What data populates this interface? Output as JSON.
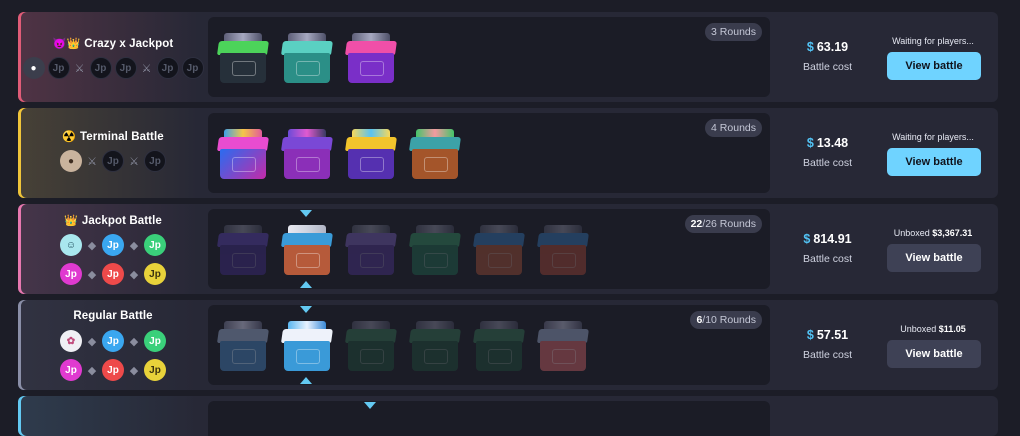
{
  "battles": [
    {
      "mode_icon": "😈👑",
      "title": "Crazy x Jackpot",
      "rounds": "3 Rounds",
      "price": "63.19",
      "cost_label": "Battle cost",
      "status": "Waiting for players...",
      "button": "View battle",
      "accent": "#e05c78"
    },
    {
      "mode_icon": "☢️",
      "title": "Terminal Battle",
      "rounds": "4 Rounds",
      "price": "13.48",
      "cost_label": "Battle cost",
      "status": "Waiting for players...",
      "button": "View battle",
      "accent": "#f0c53a"
    },
    {
      "mode_icon": "👑",
      "title": "Jackpot Battle",
      "rounds_current": "22",
      "rounds_total": "/26 Rounds",
      "price": "814.91",
      "cost_label": "Battle cost",
      "status_prefix": "Unboxed",
      "status_value": "$3,367.31",
      "button": "View battle",
      "accent": "#e778b0"
    },
    {
      "mode_icon": "",
      "title": "Regular Battle",
      "rounds_current": "6",
      "rounds_total": "/10 Rounds",
      "price": "57.51",
      "cost_label": "Battle cost",
      "status_prefix": "Unboxed",
      "status_value": "$11.05",
      "button": "View battle",
      "accent": "#8a8fa8"
    }
  ],
  "currency_symbol": "$",
  "player_slot_logo": "Jp",
  "versus_icon": "crossed-swords-icon",
  "team_icon": "diamond-icon"
}
